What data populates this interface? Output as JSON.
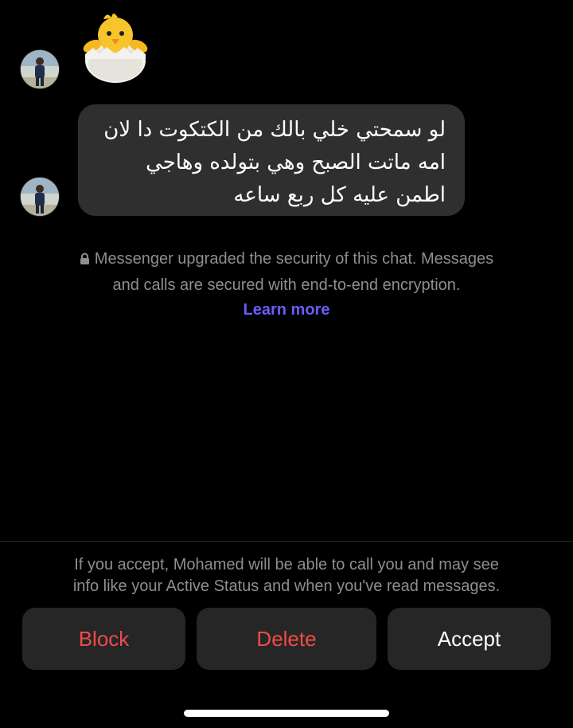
{
  "conversation": {
    "sticker": {
      "icon": "hatching-chick-icon"
    },
    "message": {
      "lines": [
        "لو سمحتي خلي بالك من الكتكوت دا لان",
        "امه ماتت الصبح وهي بتولده وهاجي",
        "اطمن عليه كل ربع ساعه"
      ]
    },
    "security_notice": {
      "icon": "lock-icon",
      "line1": "Messenger upgraded the security of this chat. Messages",
      "line2": "and calls are secured with end-to-end encryption.",
      "link": "Learn more"
    }
  },
  "request_panel": {
    "info_line1": "If you accept, Mohamed will be able to call you and may see",
    "info_line2": "info like your Active Status and when you've read messages.",
    "buttons": {
      "block": "Block",
      "delete": "Delete",
      "accept": "Accept"
    }
  },
  "colors": {
    "background": "#000000",
    "bubble": "#2f2f2f",
    "muted_text": "#8e8e8e",
    "link": "#6b5cff",
    "destructive": "#ef4b4b",
    "button_bg": "#262626"
  }
}
